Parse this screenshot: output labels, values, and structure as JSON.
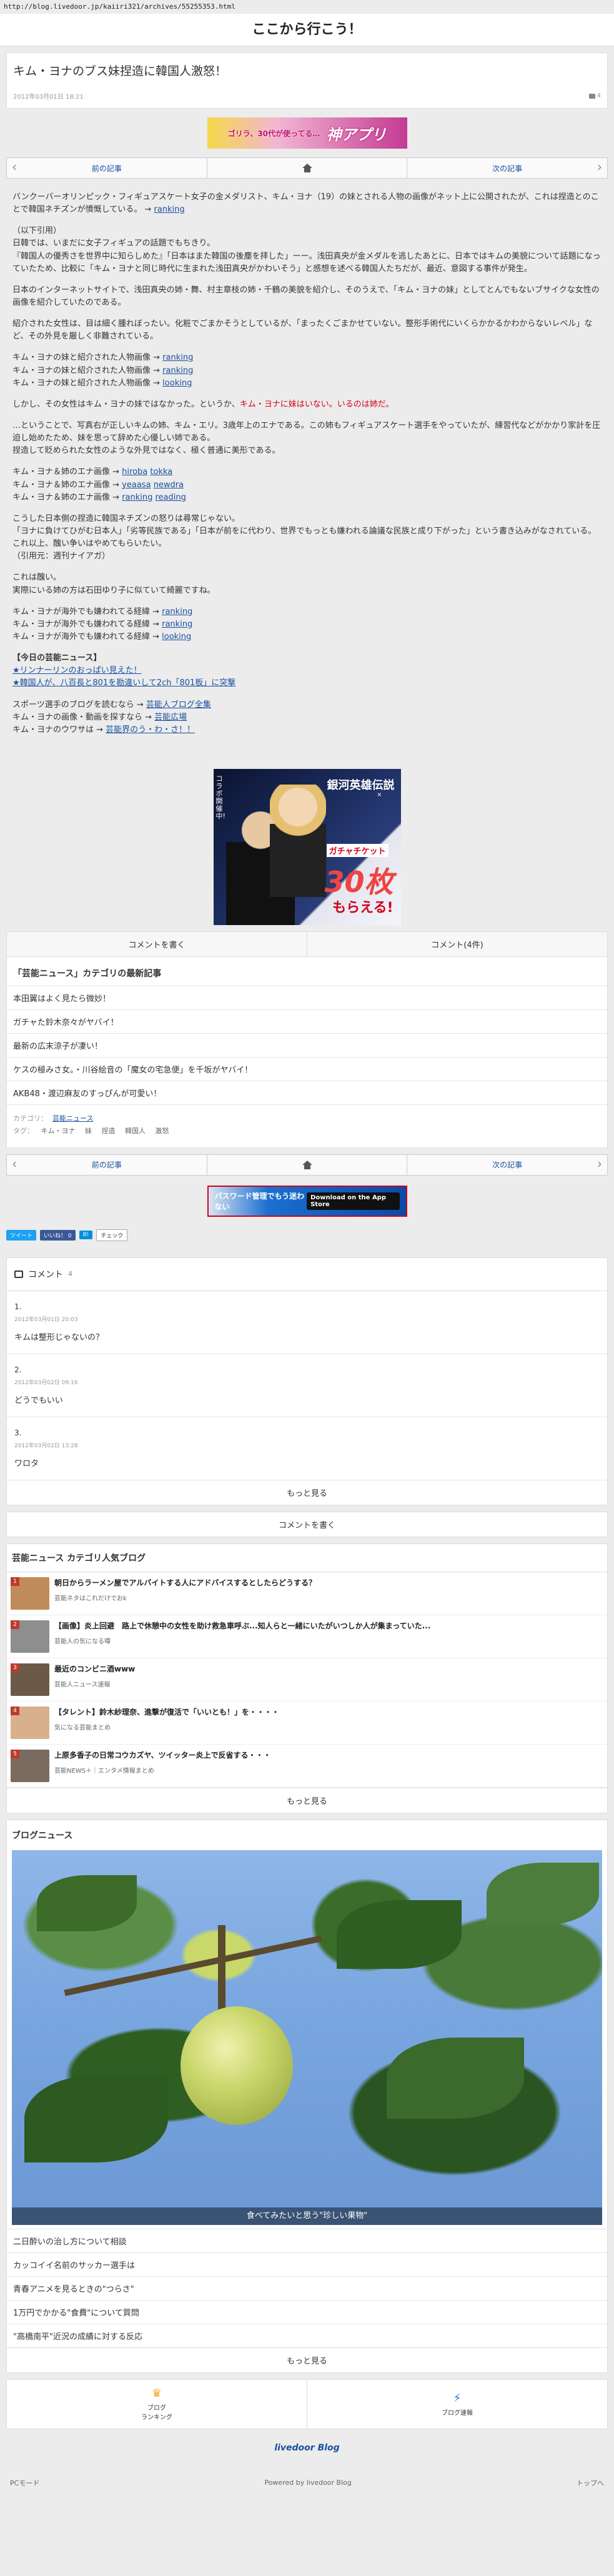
{
  "url": "http://blog.livedoor.jp/kaiiri321/archives/55255353.html",
  "site_title": "ここから行こう！",
  "article": {
    "title": "キム・ヨナのブス妹捏造に韓国人激怒！",
    "date": "2012年03月01日 18:21",
    "comment_count": "4"
  },
  "ad_top": {
    "small": "ゴリラ、30代が使ってる…",
    "big": "神アプリ"
  },
  "nav": {
    "prev": "前の記事",
    "next": "次の記事"
  },
  "body": {
    "p1": [
      "バンクーバーオリンピック・フィギュアスケート女子の金メダリスト、キム・ヨナ（19）の妹とされる人物の画像がネット上に公開されたが、これは捏造とのことで韓国ネチズンが憤慨している。 → ",
      "ranking"
    ],
    "p2_lines": [
      "（以下引用）",
      "日韓では、いまだに女子フィギュアの話題でもちきり。",
      "『韓国人の優秀さを世界中に知らしめた』「日本はまた韓国の後塵を拝した」ーー。浅田真央が金メダルを逃したあとに、日本ではキムの美貌について話題になっていたため、比較に「キム・ヨナと同じ時代に生まれた浅田真央がかわいそう」と感想を述べる韓国人たちだが、最近、意図する事件が発生。"
    ],
    "p3_lines": [
      "日本のインターネットサイトで、浅田真央の姉・舞、村主章枝の姉・千鶴の美貌を紹介し、そのうえで、「キム・ヨナの妹」としてとんでもないブサイクな女性の画像を紹介していたのである。"
    ],
    "p4_lines": [
      "紹介された女性は、目は細く腫れぼったい。化粧でごまかそうとしているが、「まったくごまかせていない。整形手術代にいくらかかるかわからないレベル」など、その外見を厳しく非難されている。"
    ],
    "list1": [
      {
        "text": "キム・ヨナの妹と紹介された人物画像 → ",
        "link": "ranking"
      },
      {
        "text": "キム・ヨナの妹と紹介された人物画像 → ",
        "link": "ranking"
      },
      {
        "text": "キム・ヨナの妹と紹介された人物画像 → ",
        "link": "looking"
      }
    ],
    "p5_pre": "しかし、その女性はキム・ヨナの妹ではなかった。というか、",
    "p5_red": "キム・ヨナに妹はいない。いるのは姉だ。",
    "p6_lines": [
      "…ということで、写真右が正しいキムの姉、キム・エリ。3歳年上のエナである。この姉もフィギュアスケート選手をやっていたが、練習代などがかかり家計を圧迫し始めたため、妹を思って辞めた心優しい姉である。",
      "捏造して貶められた女性のような外見ではなく、極く普通に美形である。"
    ],
    "list2": [
      {
        "text": "キム・ヨナ＆姉のエナ画像 → ",
        "links": [
          "hiroba",
          "tokka"
        ]
      },
      {
        "text": "キム・ヨナ＆姉のエナ画像 → ",
        "links": [
          "yeaasa",
          "newdra"
        ]
      },
      {
        "text": "キム・ヨナ＆姉のエナ画像 → ",
        "links": [
          "ranking",
          "reading"
        ]
      }
    ],
    "p7_lines": [
      "こうした日本側の捏造に韓国ネチズンの怒りは尋常じゃない。",
      "「ヨナに負けてひがむ日本人」「劣等民族である」「日本が前をに代わり、世界でもっとも嫌われる論議な民族と成り下がった」という書き込みがなされている。",
      "これ以上、醜い争いはやめてもらいたい。",
      "（引用元：週刊ナイアガ）"
    ],
    "p8_lines": [
      "これは醜い。",
      "実際にいる姉の方は石田ゆり子に似ていて綺麗ですね。"
    ],
    "list3": [
      {
        "text": "キム・ヨナが海外でも嫌われてる経緯 → ",
        "link": "ranking"
      },
      {
        "text": "キム・ヨナが海外でも嫌われてる経緯 → ",
        "link": "ranking"
      },
      {
        "text": "キム・ヨナが海外でも嫌われてる経緯 → ",
        "link": "looking"
      }
    ],
    "news_header": "【今日の芸能ニュース】",
    "news_items": [
      "★リンナーリンのおっぱい見えた！",
      "★韓国人が、八百長と801を勘違いして2ch「801板」に突撃"
    ],
    "sports_lines": [
      {
        "text": "スポーツ選手のブログを読むなら → ",
        "link": "芸能人ブログ全集"
      },
      {
        "text": "キム・ヨナの画像・動画を探すなら → ",
        "link": "芸能広場"
      },
      {
        "text": "キム・ヨナのウワサは → ",
        "link": "芸能界のう・わ・さ！！"
      }
    ]
  },
  "image_ad": {
    "t1": "銀河英雄伝説",
    "t2": "×",
    "t3": "ガチャチケット",
    "t4": "30枚",
    "t5": "もらえる!",
    "vert": "コラボ開催中!"
  },
  "buttons": {
    "write": "コメントを書く",
    "comments": "コメント(4件)"
  },
  "category_section": {
    "title": "「芸能ニュース」カテゴリの最新記事",
    "items": [
      "本田翼はよく見たら微妙！",
      "ガチャた鈴木奈々がヤバイ！",
      "最新の広末涼子が凄い！",
      "ケスの極みさ女。・川谷絵音の「魔女の宅急便」を千坂がヤバイ！",
      "AKB48・渡辺麻友のすっぴんが可愛い！"
    ],
    "category_label": "カテゴリ：",
    "category_value": "芸能ニュース",
    "tag_label": "タグ：",
    "tags": [
      "キム・ヨナ",
      "妹",
      "捏造",
      "韓国人",
      "激怒"
    ]
  },
  "blue_ad": {
    "text": "パスワード管理でもう迷わない",
    "store": "Download on the App Store"
  },
  "social": {
    "tweet": "ツイート",
    "like": "いいね！ 0",
    "hatena": "B!",
    "check": "チェック"
  },
  "comments": {
    "header": "コメント",
    "count": "4",
    "items": [
      {
        "num": "1.",
        "date": "2012年03月01日 20:03",
        "text": "キムは整形じゃないの？"
      },
      {
        "num": "2.",
        "date": "2012年03月02日 09:16",
        "text": "どうでもいい"
      },
      {
        "num": "3.",
        "date": "2012年03月02日 13:28",
        "text": "ワロタ"
      }
    ],
    "more": "もっと見る",
    "write": "コメントを書く"
  },
  "ranking": {
    "title": "芸能ニュース カテゴリ人気ブログ",
    "items": [
      {
        "no": "1",
        "title": "朝日からラーメン屋でアルバイトする人にアドバイスするとしたらどうする？",
        "sub": "芸能ネタはこれだけでおk",
        "color": "#c08b5a"
      },
      {
        "no": "2",
        "title": "【画像】炎上回避　路上で休憩中の女性を助け救急車呼ぶ...知人らと一緒にいたがいつしか人が集まっていた...",
        "sub": "芸能人の気になる噂",
        "color": "#8e8e8e"
      },
      {
        "no": "3",
        "title": "最近のコンビニ酒www",
        "sub": "芸能人ニュース速報",
        "color": "#6b5a48"
      },
      {
        "no": "4",
        "title": "【タレント】鈴木紗理奈、進撃が復活で「いいとも！」を・・・・",
        "sub": "気になる芸能まとめ",
        "color": "#d9b08c"
      },
      {
        "no": "5",
        "title": "上原多香子の日常コウカズヤ、ツイッター炎上で反省する・・・",
        "sub": "芸能NEWS＋｜エンタメ情報まとめ",
        "color": "#7a6b60"
      }
    ],
    "more": "もっと見る"
  },
  "blog_news": {
    "title": "ブログニュース",
    "caption": "食べてみたいと思う\"珍しい果物\"",
    "items": [
      "二日酔いの治し方について相談",
      "カッコイイ名前のサッカー選手は",
      "青春アニメを見るときの\"つらさ\"",
      "1万円でかかる\"食費\"について質問",
      "\"高橋南平\"近況の成績に対する反応"
    ],
    "more": "もっと見る"
  },
  "footer": {
    "ranking": "ブログ\nランキング",
    "reading": "ブログ速報",
    "logo": "livedoor Blog",
    "pc": "PCモード",
    "powered": "Powered by livedoor Blog",
    "top": "トップへ"
  }
}
